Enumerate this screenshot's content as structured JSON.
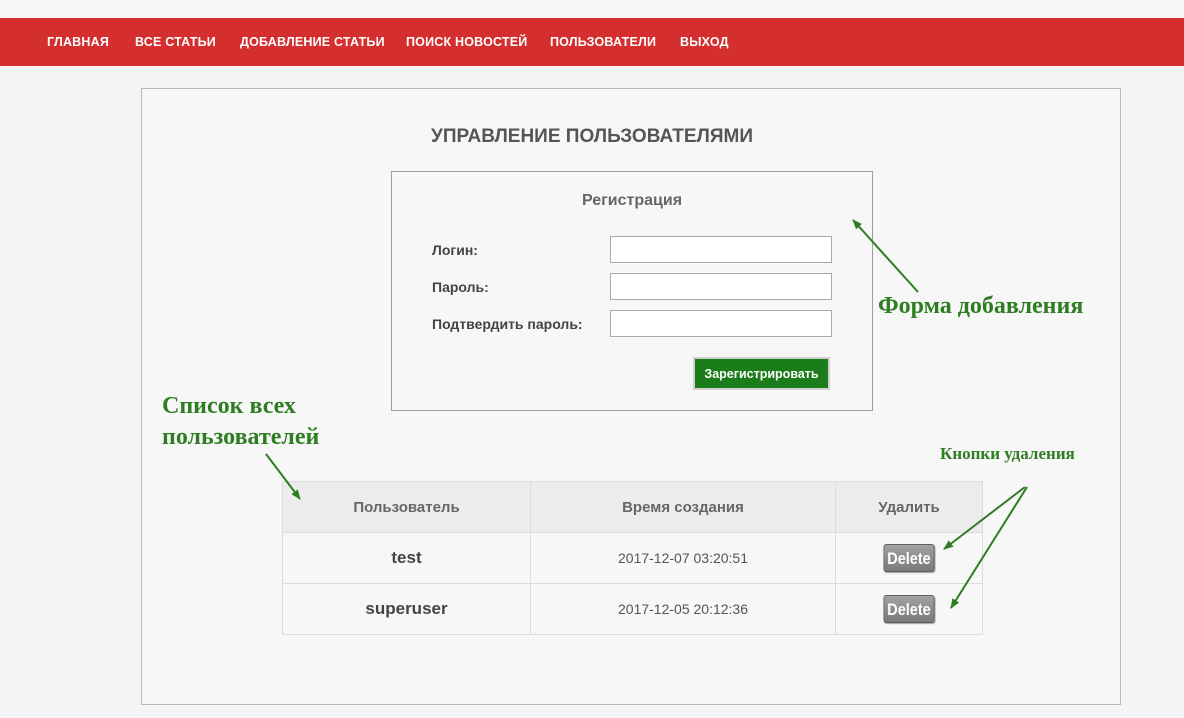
{
  "nav": {
    "items": [
      "ГЛАВНАЯ",
      "ВСЕ СТАТЬИ",
      "ДОБАВЛЕНИЕ СТАТЬИ",
      "ПОИСК НОВОСТЕЙ",
      "ПОЛЬЗОВАТЕЛИ",
      "ВЫХОД"
    ]
  },
  "page": {
    "title": "УПРАВЛЕНИЕ ПОЛЬЗОВАТЕЛЯМИ"
  },
  "registration": {
    "title": "Регистрация",
    "login_label": "Логин:",
    "password_label": "Пароль:",
    "confirm_label": "Подтвердить пароль:",
    "login_value": "",
    "password_value": "",
    "confirm_value": "",
    "submit_label": "Зарегистрировать"
  },
  "table": {
    "headers": [
      "Пользователь",
      "Время создания",
      "Удалить"
    ],
    "rows": [
      {
        "user": "test",
        "created": "2017-12-07 03:20:51",
        "action": "Delete"
      },
      {
        "user": "superuser",
        "created": "2017-12-05 20:12:36",
        "action": "Delete"
      }
    ]
  },
  "annotations": {
    "form": "Форма добавления",
    "list_line1": "Список всех",
    "list_line2": "пользователей",
    "delete_buttons": "Кнопки удаления"
  },
  "colors": {
    "navbar": "#d42e2e",
    "register_button": "#1a7d1a",
    "annotation": "#2e7d22",
    "delete_button": "#8a8a8a"
  }
}
